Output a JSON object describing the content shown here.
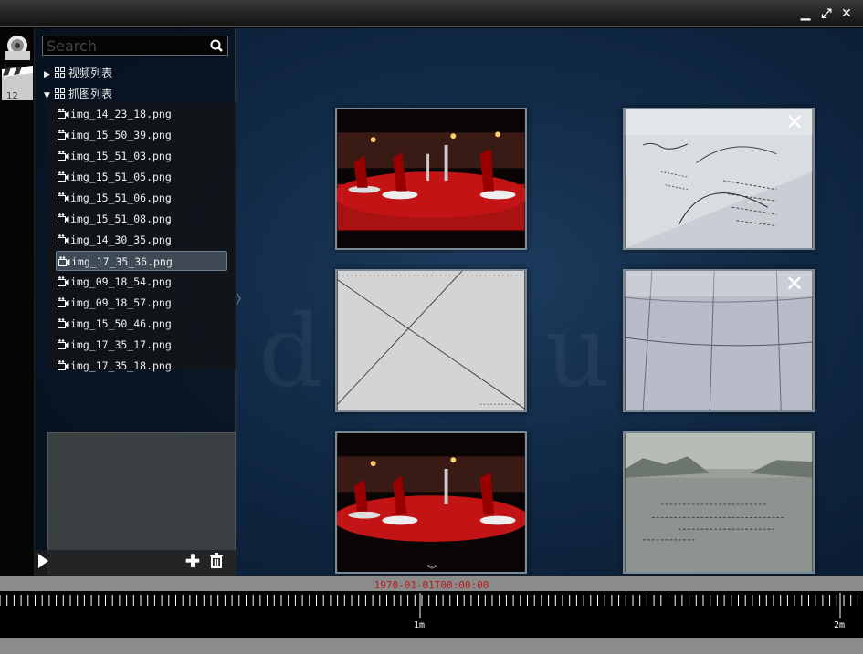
{
  "window": {
    "controls": [
      {
        "name": "minimize-icon",
        "glyph": "▁"
      },
      {
        "name": "maximize-icon",
        "glyph": "⤢"
      },
      {
        "name": "close-icon",
        "glyph": "✕"
      }
    ]
  },
  "sidebar": {
    "search_placeholder": "Search",
    "groups": [
      {
        "label": "视频列表",
        "expanded": false
      },
      {
        "label": "抓图列表",
        "expanded": true
      }
    ],
    "files": [
      "img_14_23_18.png",
      "img_15_50_39.png",
      "img_15_51_03.png",
      "img_15_51_05.png",
      "img_15_51_06.png",
      "img_15_51_08.png",
      "img_14_30_35.png",
      "img_17_35_36.png",
      "img_09_18_54.png",
      "img_09_18_57.png",
      "img_15_50_46.png",
      "img_17_35_17.png",
      "img_17_35_18.png"
    ],
    "selected_file": "img_17_35_36.png",
    "bottom_tools": {
      "play_icon": "play-icon",
      "add_icon": "plus-icon",
      "delete_icon": "trash-icon"
    }
  },
  "main": {
    "watermark": "default",
    "thumbnails": [
      {
        "scene": "banquet",
        "has_close": false
      },
      {
        "scene": "notes",
        "has_close": true
      },
      {
        "scene": "tiles",
        "has_close": false
      },
      {
        "scene": "ceiling",
        "has_close": true
      },
      {
        "scene": "banquet",
        "has_close": false
      },
      {
        "scene": "river",
        "has_close": false
      }
    ],
    "close_glyph": "✕"
  },
  "timeline": {
    "current_time": "1970-01-01T00:00:00",
    "tick_labels": [
      "1m",
      "2m"
    ]
  },
  "colors": {
    "time_label": "#c01818",
    "selection": "#6a7e92",
    "background": "#112a46"
  }
}
